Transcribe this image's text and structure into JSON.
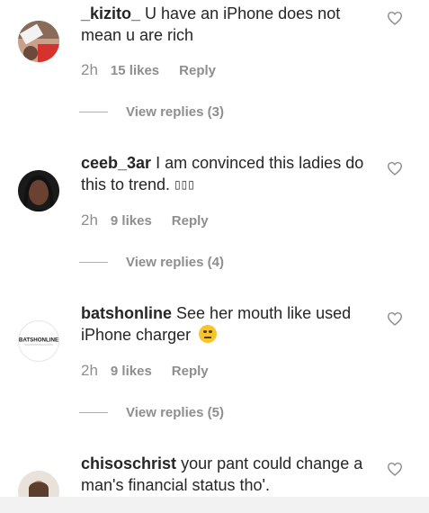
{
  "comments": [
    {
      "username": "_kizito_",
      "text": "U have an iPhone does not mean u are rich",
      "time": "2h",
      "likes": "15 likes",
      "reply": "Reply",
      "view_replies": "View replies (3)",
      "avatar_icon": "avatar-photo"
    },
    {
      "username": "ceeb_3ar",
      "text": "I am convinced this ladies do this to trend.",
      "emoji_text": "▯▯▯",
      "time": "2h",
      "likes": "9 likes",
      "reply": "Reply",
      "view_replies": "View replies (4)",
      "avatar_icon": "avatar-photo"
    },
    {
      "username": "batshonline",
      "text": "See her mouth like used iPhone charger",
      "emoji_icon": "unamused-face-emoji",
      "time": "2h",
      "likes": "9 likes",
      "reply": "Reply",
      "view_replies": "View replies (5)",
      "avatar_logo_text": "BATSHONLINE",
      "avatar_icon": "batshonline-logo"
    },
    {
      "username": "chisoschrist",
      "text": "your pant could change a man's financial status tho'.",
      "avatar_icon": "avatar-photo"
    }
  ],
  "icons": {
    "like": "heart-outline-icon"
  },
  "colors": {
    "text": "#262626",
    "muted": "#8e8e8e",
    "divider": "#b0b0b0"
  }
}
